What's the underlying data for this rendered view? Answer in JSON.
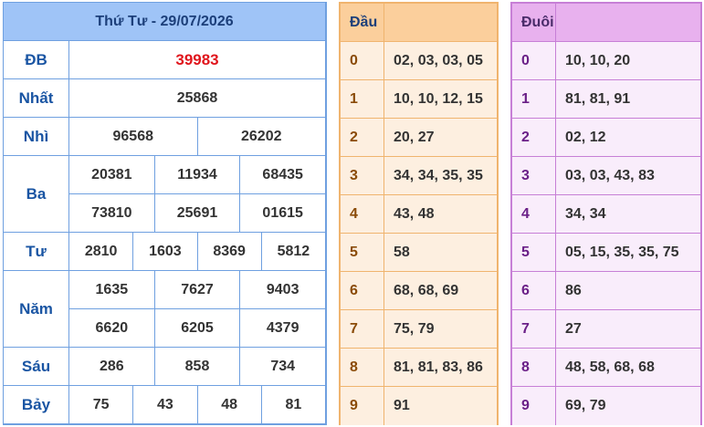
{
  "results": {
    "title": "Thứ Tư - 29/07/2026",
    "prizes": {
      "db": {
        "label": "ĐB",
        "values": [
          "39983"
        ]
      },
      "nhat": {
        "label": "Nhất",
        "values": [
          "25868"
        ]
      },
      "nhi": {
        "label": "Nhì",
        "values": [
          "96568",
          "26202"
        ]
      },
      "ba": {
        "label": "Ba",
        "values": [
          "20381",
          "11934",
          "68435",
          "73810",
          "25691",
          "01615"
        ]
      },
      "tu": {
        "label": "Tư",
        "values": [
          "2810",
          "1603",
          "8369",
          "5812"
        ]
      },
      "nam": {
        "label": "Năm",
        "values": [
          "1635",
          "7627",
          "9403",
          "6620",
          "6205",
          "4379"
        ]
      },
      "sau": {
        "label": "Sáu",
        "values": [
          "286",
          "858",
          "734"
        ]
      },
      "bay": {
        "label": "Bảy",
        "values": [
          "75",
          "43",
          "48",
          "81"
        ]
      }
    }
  },
  "dau": {
    "header": "Đầu",
    "rows": [
      {
        "k": "0",
        "v": "02, 03, 03, 05"
      },
      {
        "k": "1",
        "v": "10, 10, 12, 15"
      },
      {
        "k": "2",
        "v": "20, 27"
      },
      {
        "k": "3",
        "v": "34, 34, 35, 35"
      },
      {
        "k": "4",
        "v": "43, 48"
      },
      {
        "k": "5",
        "v": "58"
      },
      {
        "k": "6",
        "v": "68, 68, 69"
      },
      {
        "k": "7",
        "v": "75, 79"
      },
      {
        "k": "8",
        "v": "81, 81, 83, 86"
      },
      {
        "k": "9",
        "v": "91"
      }
    ]
  },
  "duoi": {
    "header": "Đuôi",
    "rows": [
      {
        "k": "0",
        "v": "10, 10, 20"
      },
      {
        "k": "1",
        "v": "81, 81, 91"
      },
      {
        "k": "2",
        "v": "02, 12"
      },
      {
        "k": "3",
        "v": "03, 03, 43, 83"
      },
      {
        "k": "4",
        "v": "34, 34"
      },
      {
        "k": "5",
        "v": "05, 15, 35, 35, 75"
      },
      {
        "k": "6",
        "v": "86"
      },
      {
        "k": "7",
        "v": "27"
      },
      {
        "k": "8",
        "v": "48, 58, 68, 68"
      },
      {
        "k": "9",
        "v": "69, 79"
      }
    ]
  },
  "colors": {
    "results_header": "#9fc4f7",
    "special_prize": "#e0151c",
    "dau_header": "#fbcf9c",
    "duoi_header": "#e8b1ee"
  }
}
